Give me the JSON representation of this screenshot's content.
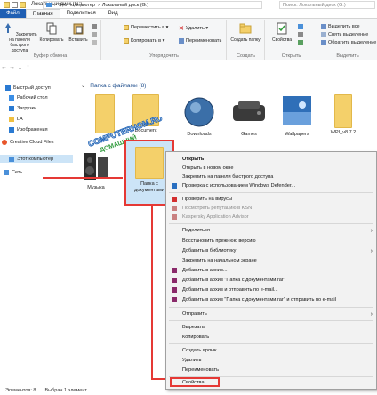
{
  "window": {
    "title": "Локальный диск (G:)"
  },
  "ribbon_tabs": [
    {
      "label": "Файл"
    },
    {
      "label": "Главная"
    },
    {
      "label": "Поделиться"
    },
    {
      "label": "Вид"
    }
  ],
  "ribbon": {
    "clipboard": {
      "pin_label": "Закрепить на панели быстрого доступа",
      "copy_label": "Копировать",
      "paste_label": "Вставить",
      "group_label": "Буфер обмена"
    },
    "organize": {
      "move_to": "Переместить в ▾",
      "copy_to": "Копировать в ▾",
      "delete": "Удалить ▾",
      "rename": "Переименовать",
      "group_label": "Упорядочить"
    },
    "new": {
      "new_folder": "Создать папку",
      "group_label": "Создать"
    },
    "open": {
      "properties": "Свойства",
      "group_label": "Открыть"
    },
    "select": {
      "select_all": "Выделить все",
      "select_none": "Снять выделение",
      "invert": "Обратить выделение",
      "group_label": "Выделить"
    }
  },
  "address": {
    "crumbs": [
      "Этот компьютер",
      "Локальный диск (G:)"
    ],
    "search_placeholder": "Поиск: Локальный диск (G:)"
  },
  "nav": {
    "items": [
      {
        "label": "Быстрый доступ",
        "color": "#2a7ad2"
      },
      {
        "label": "Рабочий стол",
        "color": "#3a8ee6"
      },
      {
        "label": "Загрузки",
        "color": "#2a7ad2"
      },
      {
        "label": "LA",
        "color": "#f0c040"
      },
      {
        "label": "Изображения",
        "color": "#2a7ad2"
      },
      {
        "label": "Creative Cloud Files",
        "color": "#e8552a"
      },
      {
        "label": "Этот компьютер",
        "color": "#4a90d9"
      },
      {
        "label": "Сеть",
        "color": "#4a90d9"
      }
    ]
  },
  "content": {
    "group_title": "Папка с файлами (8)",
    "folders": [
      {
        "label": "Document"
      },
      {
        "label": "Downloads"
      },
      {
        "label": "Games"
      },
      {
        "label": "Wallpapers"
      },
      {
        "label": "WPI_v8.7.2"
      },
      {
        "label": "Музыка"
      }
    ],
    "selected_folder": {
      "label": "Папка с документами"
    },
    "watermark": {
      "line1": "COMPUTERHOM.RU",
      "line2": "ДОМАШНИЙ"
    }
  },
  "context_menu": {
    "items": [
      {
        "label": "Открыть",
        "bold": true
      },
      {
        "label": "Открыть в новом окне"
      },
      {
        "label": "Закрепить на панели быстрого доступа"
      },
      {
        "label": "Проверка с использованием Windows Defender..."
      },
      {
        "label": "Проверить на вирусы"
      },
      {
        "label": "Посмотреть репутацию в KSN",
        "disabled": true
      },
      {
        "label": "Kaspersky Application Advisor",
        "disabled": true
      },
      {
        "label": "Поделиться"
      },
      {
        "label": "Восстановить прежнюю версию"
      },
      {
        "label": "Добавить в библиотеку"
      },
      {
        "label": "Закрепить на начальном экране"
      },
      {
        "label": "Добавить в архив..."
      },
      {
        "label": "Добавить в архив \"Папка с документами.rar\""
      },
      {
        "label": "Добавить в архив и отправить по e-mail..."
      },
      {
        "label": "Добавить в архив \"Папка с документами.rar\" и отправить по e-mail"
      },
      {
        "label": "Отправить"
      },
      {
        "label": "Вырезать"
      },
      {
        "label": "Копировать"
      },
      {
        "label": "Создать ярлык"
      },
      {
        "label": "Удалить"
      },
      {
        "label": "Переименовать"
      },
      {
        "label": "Свойства"
      }
    ]
  },
  "status": {
    "count": "Элементов: 8",
    "selected": "Выбран 1 элемент"
  },
  "colors": {
    "accent": "#1f5fb3",
    "highlight": "#e53935",
    "selection": "#cce4f7",
    "folder": "#f4d06a"
  }
}
